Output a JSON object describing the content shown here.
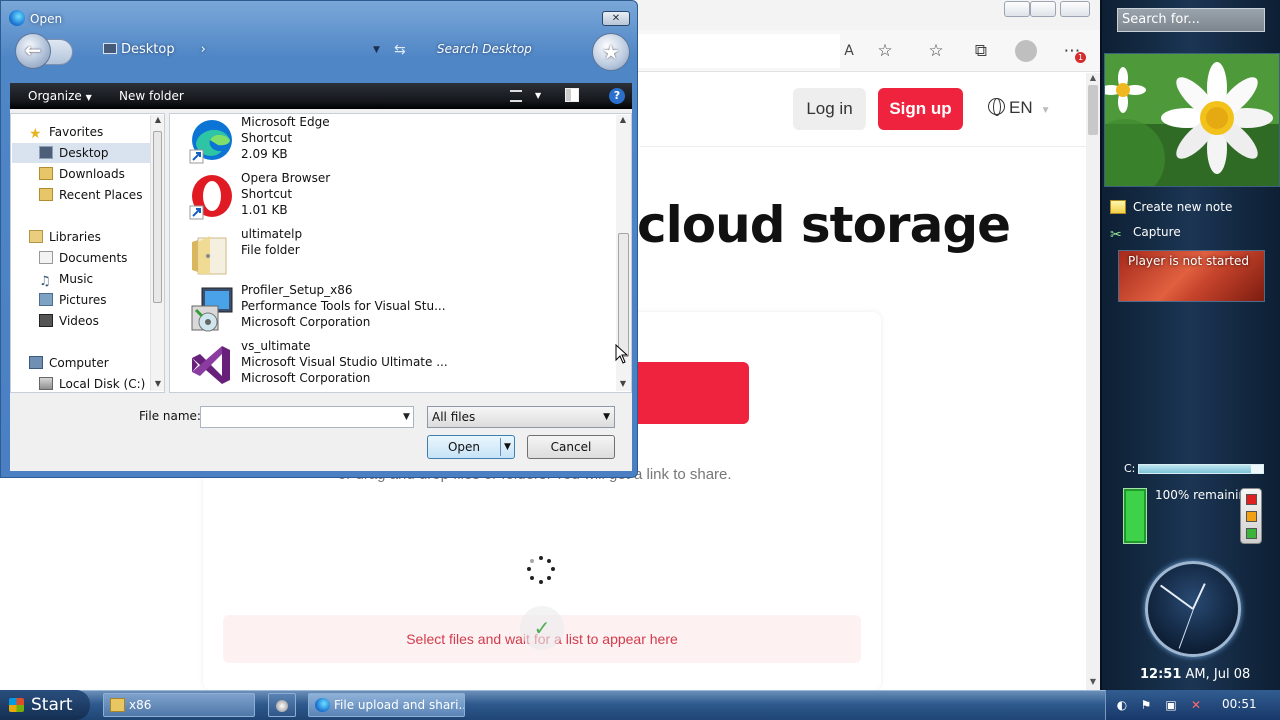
{
  "browser": {
    "header": {
      "login": "Log in",
      "signup": "Sign up",
      "language": "EN"
    },
    "hero_title": "cloud storage",
    "share_text": "or drag and drop files or folders. You will get a link to share.",
    "file_list_hint": "Select files and wait for a list to appear here",
    "colors": {
      "accent": "#f0233f",
      "hint_bg": "#fdf1f2",
      "hint_text": "#d33b4b"
    }
  },
  "dialog": {
    "title": "Open",
    "breadcrumb": "Desktop",
    "search_placeholder": "Search Desktop",
    "toolbar": {
      "organize": "Organize",
      "new_folder": "New folder"
    },
    "nav": {
      "favorites": "Favorites",
      "desktop": "Desktop",
      "downloads": "Downloads",
      "recent": "Recent Places",
      "libraries": "Libraries",
      "documents": "Documents",
      "music": "Music",
      "pictures": "Pictures",
      "videos": "Videos",
      "computer": "Computer",
      "local_disk": "Local Disk (C:)"
    },
    "files": [
      {
        "name": "Microsoft Edge",
        "line2": "Shortcut",
        "line3": "2.09 KB",
        "icon": "edge-icon"
      },
      {
        "name": "Opera Browser",
        "line2": "Shortcut",
        "line3": "1.01 KB",
        "icon": "opera-icon"
      },
      {
        "name": "ultimatelp",
        "line2": "File folder",
        "line3": "",
        "icon": "folder-icon"
      },
      {
        "name": "Profiler_Setup_x86",
        "line2": "Performance Tools for Visual Stu...",
        "line3": "Microsoft Corporation",
        "icon": "installer-icon"
      },
      {
        "name": "vs_ultimate",
        "line2": "Microsoft Visual Studio Ultimate ...",
        "line3": "Microsoft Corporation",
        "icon": "visual-studio-icon"
      }
    ],
    "file_name_label": "File name:",
    "file_name_value": "",
    "file_type": "All files",
    "open_label": "Open",
    "cancel_label": "Cancel"
  },
  "sidebar": {
    "search_placeholder": "Search for...",
    "notes": {
      "create": "Create new note",
      "capture": "Capture"
    },
    "media_status": "Player is not started",
    "drive_label": "C:",
    "drive_used_fraction": 0.9,
    "battery_text": "100% remaining",
    "battery_level": 1.0,
    "clock": {
      "time": "12:51",
      "suffix": "AM, Jul 08"
    }
  },
  "taskbar": {
    "start": "Start",
    "window1": "x86",
    "window2": "File upload and shari...",
    "time": "00:51"
  }
}
